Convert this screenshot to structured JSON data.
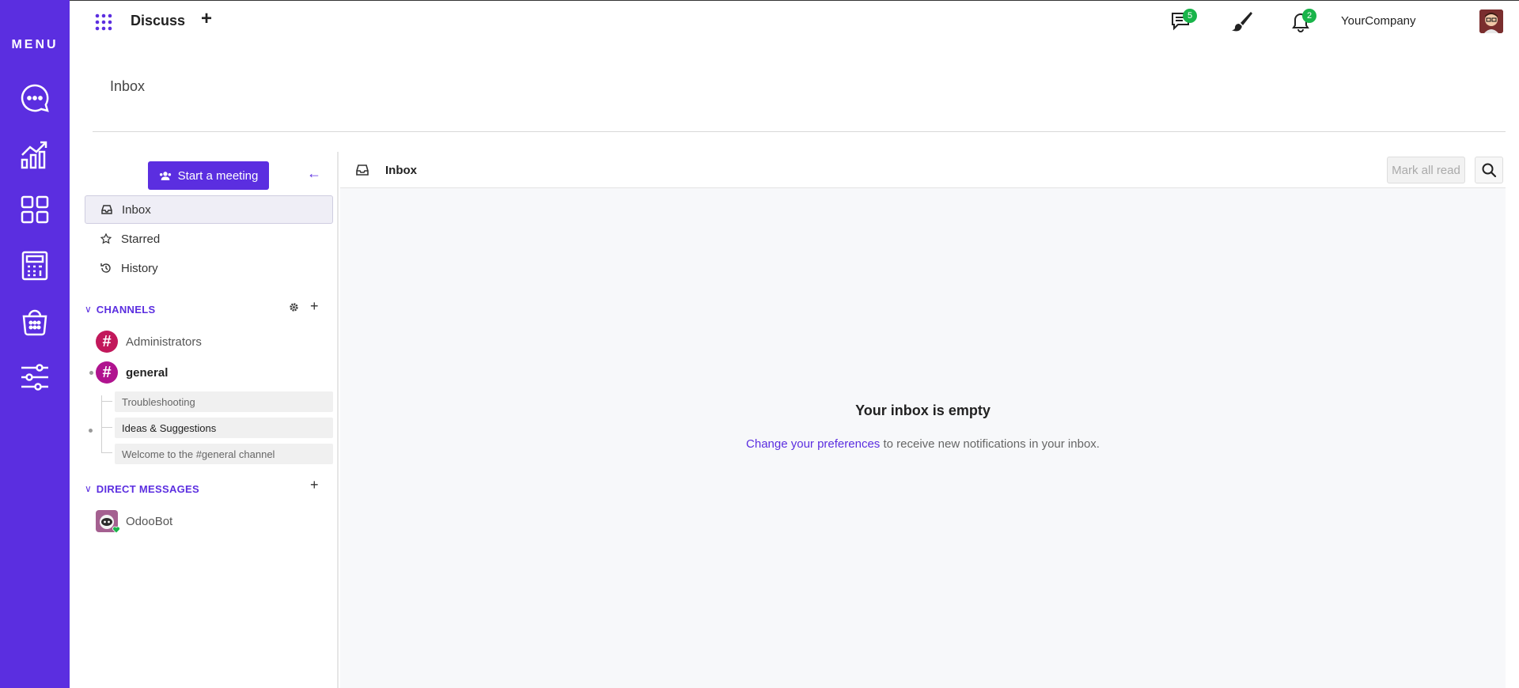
{
  "rail": {
    "menu_label": "MENU",
    "icons": [
      "chat-icon",
      "chart-icon",
      "dashboard-icon",
      "calculator-icon",
      "basket-icon",
      "sliders-icon"
    ]
  },
  "topbar": {
    "app_title": "Discuss",
    "add_label": "+",
    "messages_badge": "5",
    "activities_badge": "2",
    "company": "YourCompany"
  },
  "breadcrumb": {
    "title": "Inbox"
  },
  "sidebar": {
    "meeting_button": "Start a meeting",
    "mailboxes": [
      {
        "label": "Inbox",
        "icon": "inbox-icon"
      },
      {
        "label": "Starred",
        "icon": "star-icon"
      },
      {
        "label": "History",
        "icon": "history-icon"
      }
    ],
    "channels_header": "CHANNELS",
    "channels": [
      {
        "name": "Administrators",
        "color": "#c2185b"
      },
      {
        "name": "general",
        "color": "#b0138f"
      }
    ],
    "threads": [
      "Troubleshooting",
      "Ideas & Suggestions",
      "Welcome to the #general channel"
    ],
    "dm_header": "DIRECT MESSAGES",
    "direct_messages": [
      {
        "name": "OdooBot"
      }
    ]
  },
  "content": {
    "header_title": "Inbox",
    "mark_all_read": "Mark all read",
    "empty_title": "Your inbox is empty",
    "empty_link": "Change your preferences",
    "empty_rest": " to receive new notifications in your inbox."
  },
  "colors": {
    "accent": "#5b2ee0",
    "badge": "#19b44a"
  }
}
